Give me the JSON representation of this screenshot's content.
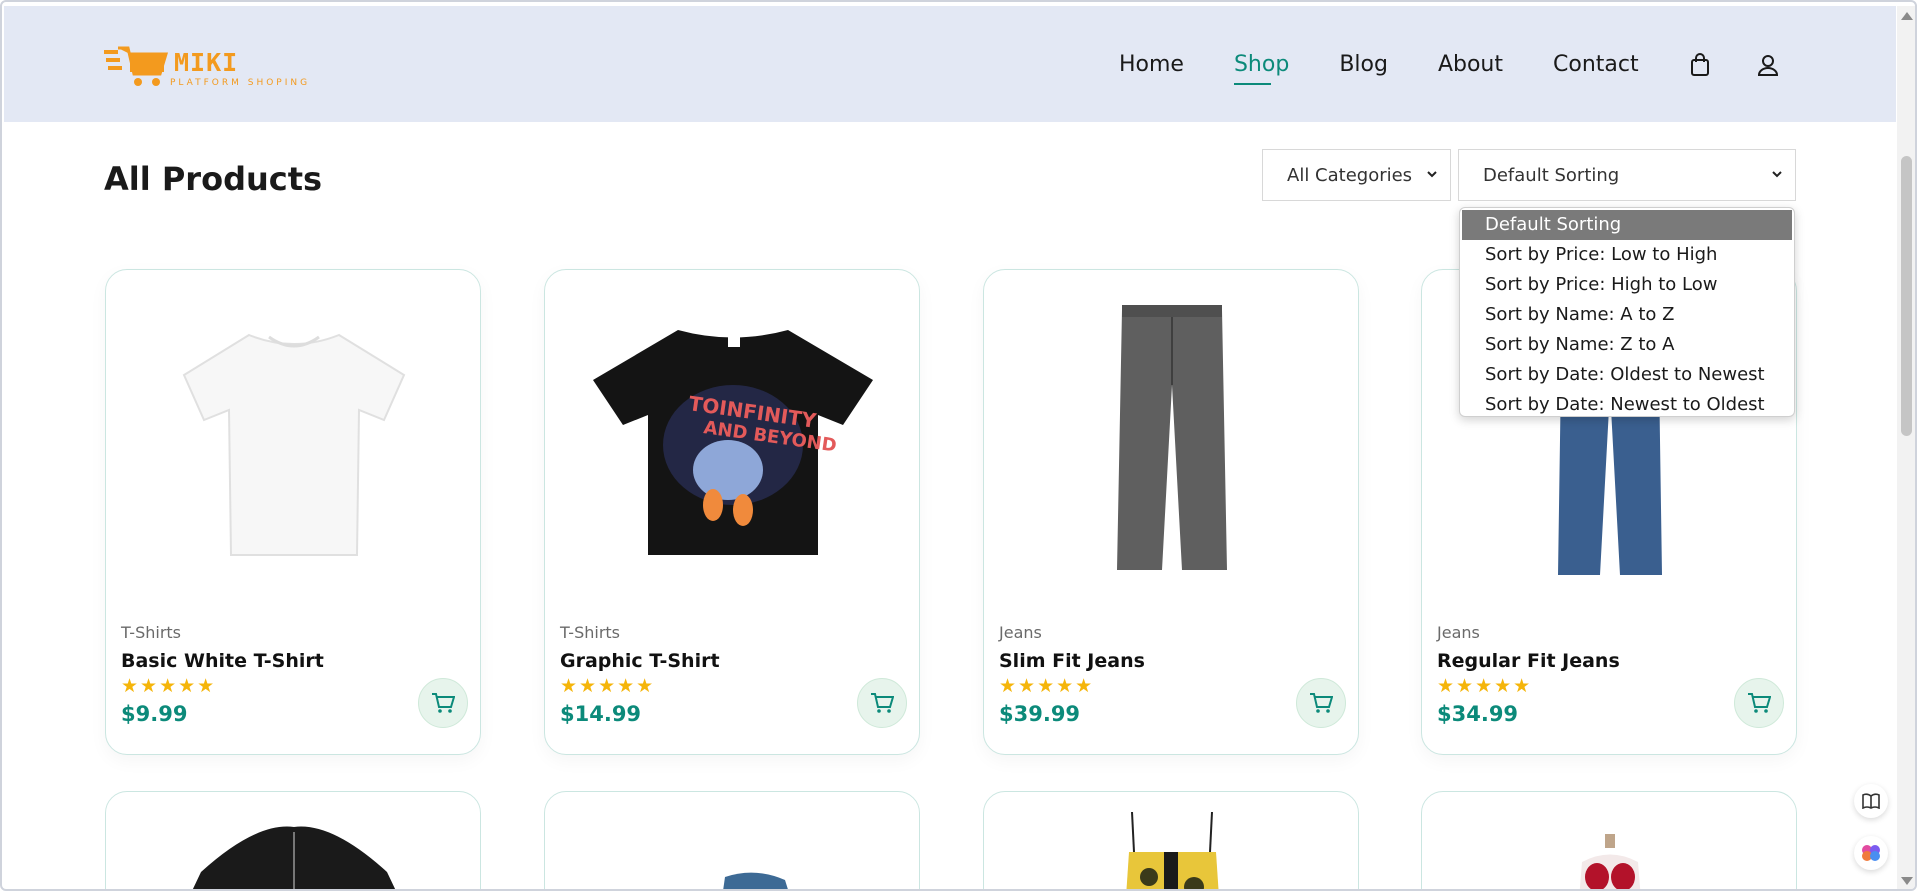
{
  "brand": {
    "name": "MIKI",
    "tagline": "PLATFORM SHOPING",
    "accent": "#f39a1e"
  },
  "nav": {
    "links": [
      {
        "label": "Home",
        "active": false
      },
      {
        "label": "Shop",
        "active": true
      },
      {
        "label": "Blog",
        "active": false
      },
      {
        "label": "About",
        "active": false
      },
      {
        "label": "Contact",
        "active": false
      }
    ],
    "icons": [
      "shopping-bag-icon",
      "user-icon"
    ],
    "active_color": "#0c8a7a"
  },
  "page": {
    "title": "All Products"
  },
  "filters": {
    "category": {
      "selected": "All Categories"
    },
    "sorting": {
      "selected": "Default Sorting",
      "options": [
        "Default Sorting",
        "Sort by Price: Low to High",
        "Sort by Price: High to Low",
        "Sort by Name: A to Z",
        "Sort by Name: Z to A",
        "Sort by Date: Oldest to Newest",
        "Sort by Date: Newest to Oldest"
      ],
      "expanded": true
    }
  },
  "products": [
    {
      "category": "T-Shirts",
      "name": "Basic White T-Shirt",
      "rating": 5,
      "stars": "★★★★★",
      "price": "$9.99",
      "image": "white-tshirt"
    },
    {
      "category": "T-Shirts",
      "name": "Graphic T-Shirt",
      "rating": 5,
      "stars": "★★★★★",
      "price": "$14.99",
      "image": "graphic-tshirt"
    },
    {
      "category": "Jeans",
      "name": "Slim Fit Jeans",
      "rating": 5,
      "stars": "★★★★★",
      "price": "$39.99",
      "image": "grey-jeans"
    },
    {
      "category": "Jeans",
      "name": "Regular Fit Jeans",
      "rating": 5,
      "stars": "★★★★★",
      "price": "$34.99",
      "image": "blue-jeans"
    }
  ],
  "second_row_images": [
    "leather-jacket",
    "denim-item",
    "floral-top",
    "red-dress"
  ],
  "colors": {
    "price": "#0c8a7a",
    "star": "#f5b50a",
    "header_bg": "#e3e8f4",
    "card_border": "#cbe6e1"
  },
  "floating": [
    "book-icon",
    "brain-icon"
  ]
}
